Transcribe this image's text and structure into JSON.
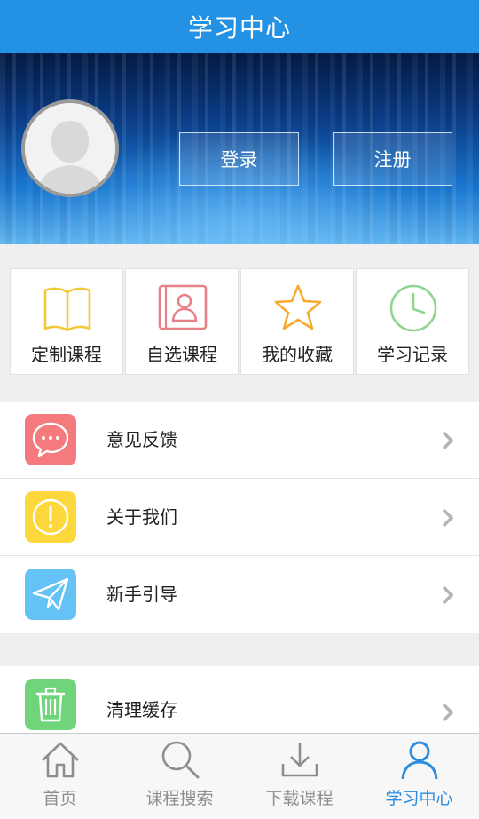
{
  "header": {
    "title": "学习中心"
  },
  "profile": {
    "login_label": "登录",
    "register_label": "注册"
  },
  "quick": [
    {
      "label": "定制课程",
      "icon": "book-icon",
      "color": "#f3c93a"
    },
    {
      "label": "自选课程",
      "icon": "contacts-book-icon",
      "color": "#e88088"
    },
    {
      "label": "我的收藏",
      "icon": "star-icon",
      "color": "#f4ab2e"
    },
    {
      "label": "学习记录",
      "icon": "clock-icon",
      "color": "#8fd48f"
    }
  ],
  "menu": [
    {
      "label": "意见反馈",
      "icon": "chat-bubble-icon",
      "color": "#f57a7e"
    },
    {
      "label": "关于我们",
      "icon": "info-exclamation-icon",
      "color": "#fcd83c"
    },
    {
      "label": "新手引导",
      "icon": "paper-plane-icon",
      "color": "#64c3f4"
    }
  ],
  "menu2": [
    {
      "label": "清理缓存",
      "icon": "trash-icon",
      "color": "#6fd47a"
    }
  ],
  "tabs": [
    {
      "label": "首页",
      "icon": "home-icon",
      "active": false
    },
    {
      "label": "课程搜索",
      "icon": "search-icon",
      "active": false
    },
    {
      "label": "下载课程",
      "icon": "download-icon",
      "active": false
    },
    {
      "label": "学习中心",
      "icon": "person-icon",
      "active": true
    }
  ],
  "colors": {
    "primary": "#2392e4",
    "active_tab": "#2a8de0",
    "inactive_tab": "#8e8e8e"
  }
}
